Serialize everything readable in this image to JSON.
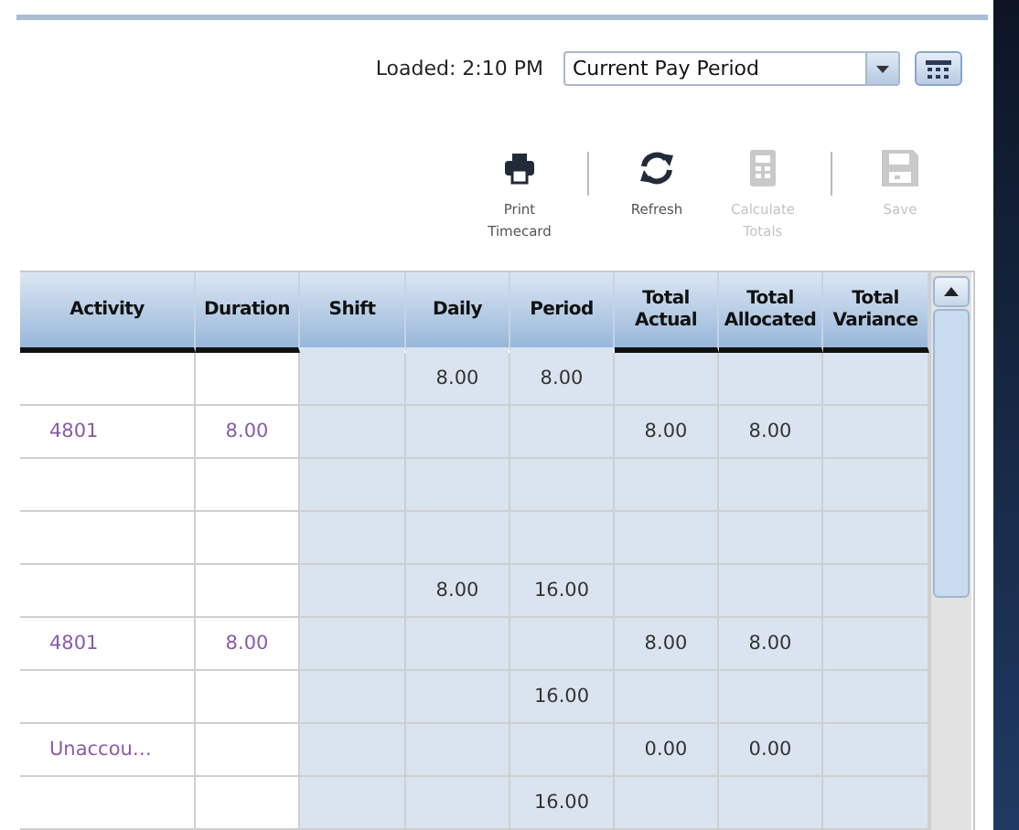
{
  "loaded": "Loaded: 2:10 PM",
  "period_select": {
    "value": "Current Pay Period"
  },
  "toolbar": [
    {
      "kind": "print",
      "label": "Print Timecard",
      "disabled": false,
      "separator_after": true
    },
    {
      "kind": "refresh",
      "label": "Refresh",
      "disabled": false,
      "separator_after": false
    },
    {
      "kind": "calculator",
      "label": "Calculate Totals",
      "disabled": true,
      "separator_after": true
    },
    {
      "kind": "save",
      "label": "Save",
      "disabled": true,
      "separator_after": false
    }
  ],
  "table": {
    "columns": [
      {
        "label": "Activity",
        "kind": "entry",
        "underlined": true
      },
      {
        "label": "Duration",
        "kind": "entry",
        "underlined": true
      },
      {
        "label": "Shift",
        "kind": "computed",
        "underlined": false
      },
      {
        "label": "Daily",
        "kind": "computed",
        "underlined": false
      },
      {
        "label": "Period",
        "kind": "computed",
        "underlined": false
      },
      {
        "label": "Total Actual",
        "kind": "computed",
        "underlined": true
      },
      {
        "label": "Total Allocated",
        "kind": "computed",
        "underlined": true
      },
      {
        "label": "Total Variance",
        "kind": "computed",
        "underlined": true
      }
    ],
    "rows": [
      [
        null,
        null,
        null,
        "8.00",
        "8.00",
        null,
        null,
        null
      ],
      [
        "4801",
        "8.00",
        null,
        null,
        null,
        "8.00",
        "8.00",
        null
      ],
      [
        null,
        null,
        null,
        null,
        null,
        null,
        null,
        null
      ],
      [
        null,
        null,
        null,
        null,
        null,
        null,
        null,
        null
      ],
      [
        null,
        null,
        null,
        "8.00",
        "16.00",
        null,
        null,
        null
      ],
      [
        "4801",
        "8.00",
        null,
        null,
        null,
        "8.00",
        "8.00",
        null
      ],
      [
        null,
        null,
        null,
        null,
        "16.00",
        null,
        null,
        null
      ],
      [
        "Unaccou…",
        null,
        null,
        null,
        null,
        "0.00",
        "0.00",
        null
      ],
      [
        null,
        null,
        null,
        null,
        "16.00",
        null,
        null,
        null
      ]
    ]
  }
}
